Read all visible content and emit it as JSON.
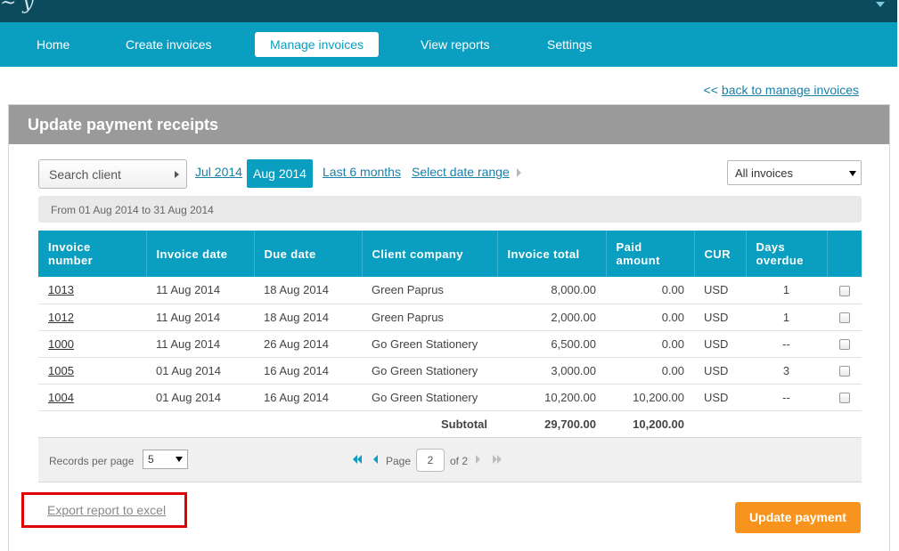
{
  "header": {
    "logo_fragment": "~ y"
  },
  "nav": {
    "items": [
      {
        "label": "Home"
      },
      {
        "label": "Create invoices"
      },
      {
        "label": "Manage invoices",
        "active": true
      },
      {
        "label": "View reports"
      },
      {
        "label": "Settings"
      }
    ]
  },
  "back_link": {
    "arrow": "<<",
    "label": "back to manage invoices"
  },
  "panel": {
    "title": "Update payment receipts"
  },
  "filters": {
    "search_placeholder": "Search client",
    "date_links": [
      "Jul 2014",
      "Aug 2014",
      "Last 6 months",
      "Select date range"
    ],
    "selected_date": "Aug 2014",
    "invoice_filter": "All invoices"
  },
  "date_range_text": "From 01 Aug 2014 to 31 Aug 2014",
  "table": {
    "columns": [
      "Invoice number",
      "Invoice date",
      "Due date",
      "Client company",
      "Invoice total",
      "Paid amount",
      "CUR",
      "Days overdue"
    ],
    "rows": [
      {
        "number": "1013",
        "invoice_date": "11 Aug 2014",
        "due_date": "18 Aug 2014",
        "client": "Green Paprus",
        "total": "8,000.00",
        "paid": "0.00",
        "cur": "USD",
        "overdue": "1"
      },
      {
        "number": "1012",
        "invoice_date": "11 Aug 2014",
        "due_date": "18 Aug 2014",
        "client": "Green Paprus",
        "total": "2,000.00",
        "paid": "0.00",
        "cur": "USD",
        "overdue": "1"
      },
      {
        "number": "1000",
        "invoice_date": "11 Aug 2014",
        "due_date": "26 Aug 2014",
        "client": "Go Green Stationery",
        "total": "6,500.00",
        "paid": "0.00",
        "cur": "USD",
        "overdue": "--"
      },
      {
        "number": "1005",
        "invoice_date": "01 Aug 2014",
        "due_date": "16 Aug 2014",
        "client": "Go Green Stationery",
        "total": "3,000.00",
        "paid": "0.00",
        "cur": "USD",
        "overdue": "3"
      },
      {
        "number": "1004",
        "invoice_date": "01 Aug 2014",
        "due_date": "16 Aug 2014",
        "client": "Go Green Stationery",
        "total": "10,200.00",
        "paid": "10,200.00",
        "cur": "USD",
        "overdue": "--"
      }
    ],
    "subtotal": {
      "label": "Subtotal",
      "total": "29,700.00",
      "paid": "10,200.00"
    }
  },
  "pager": {
    "records_label": "Records per page",
    "records_value": "5",
    "page_label": "Page",
    "page_value": "2",
    "of_label": "of 2"
  },
  "actions": {
    "export_label": "Export report to excel",
    "update_label": "Update payment"
  },
  "colors": {
    "brand": "#0a9ec0",
    "header_dark": "#0c4a5e",
    "accent_button": "#f7941d",
    "highlight_box": "#e00000"
  }
}
